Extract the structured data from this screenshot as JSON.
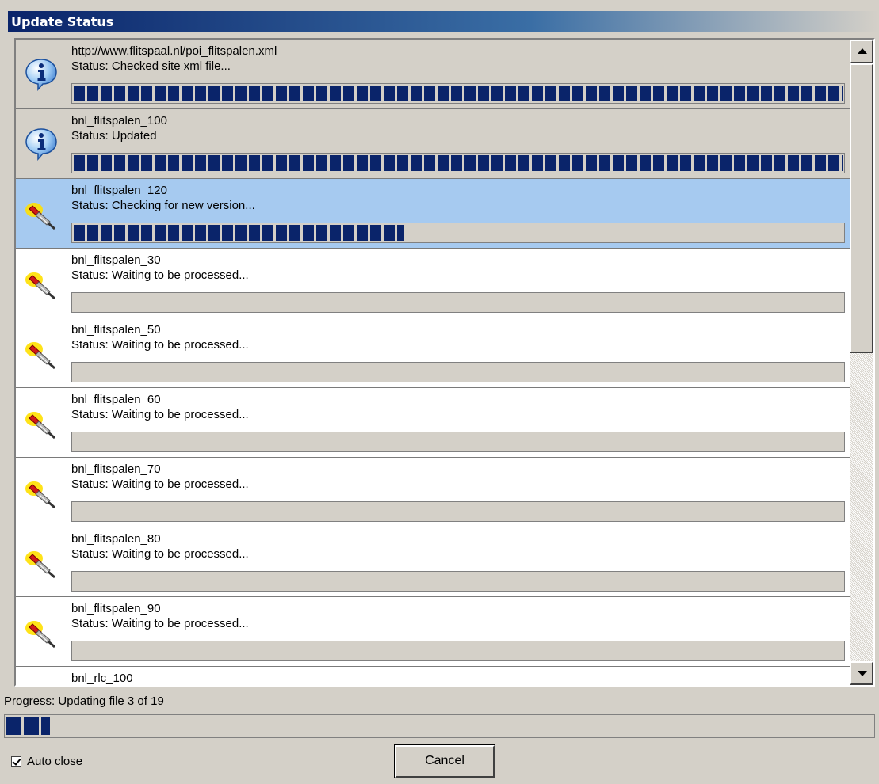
{
  "window": {
    "title": "Update Status"
  },
  "items": [
    {
      "name": "http://www.flitspaal.nl/poi_flitspalen.xml",
      "status": "Status: Checked site xml file...",
      "state": "done",
      "icon": "info-icon",
      "progress": 1.0
    },
    {
      "name": "bnl_flitspalen_100",
      "status": "Status: Updated",
      "state": "done",
      "icon": "info-icon",
      "progress": 1.0
    },
    {
      "name": "bnl_flitspalen_120",
      "status": "Status: Checking for new version...",
      "state": "active",
      "icon": "connector-icon",
      "progress": 0.43
    },
    {
      "name": "bnl_flitspalen_30",
      "status": "Status: Waiting to be processed...",
      "state": "pending",
      "icon": "connector-icon",
      "progress": 0
    },
    {
      "name": "bnl_flitspalen_50",
      "status": "Status: Waiting to be processed...",
      "state": "pending",
      "icon": "connector-icon",
      "progress": 0
    },
    {
      "name": "bnl_flitspalen_60",
      "status": "Status: Waiting to be processed...",
      "state": "pending",
      "icon": "connector-icon",
      "progress": 0
    },
    {
      "name": "bnl_flitspalen_70",
      "status": "Status: Waiting to be processed...",
      "state": "pending",
      "icon": "connector-icon",
      "progress": 0
    },
    {
      "name": "bnl_flitspalen_80",
      "status": "Status: Waiting to be processed...",
      "state": "pending",
      "icon": "connector-icon",
      "progress": 0
    },
    {
      "name": "bnl_flitspalen_90",
      "status": "Status: Waiting to be processed...",
      "state": "pending",
      "icon": "connector-icon",
      "progress": 0
    },
    {
      "name": "bnl_rlc_100",
      "status": "",
      "state": "pending",
      "icon": "connector-icon",
      "progress": 0
    }
  ],
  "overall": {
    "label": "Progress: Updating file 3 of 19",
    "progress": 0.05
  },
  "auto_close": {
    "label": "Auto close",
    "checked": true
  },
  "cancel_label": "Cancel",
  "colors": {
    "title_bar": "#0a246a",
    "progress_fill": "#0a246a",
    "selected_row": "#a6caf0",
    "window_bg": "#d4d0c8"
  }
}
